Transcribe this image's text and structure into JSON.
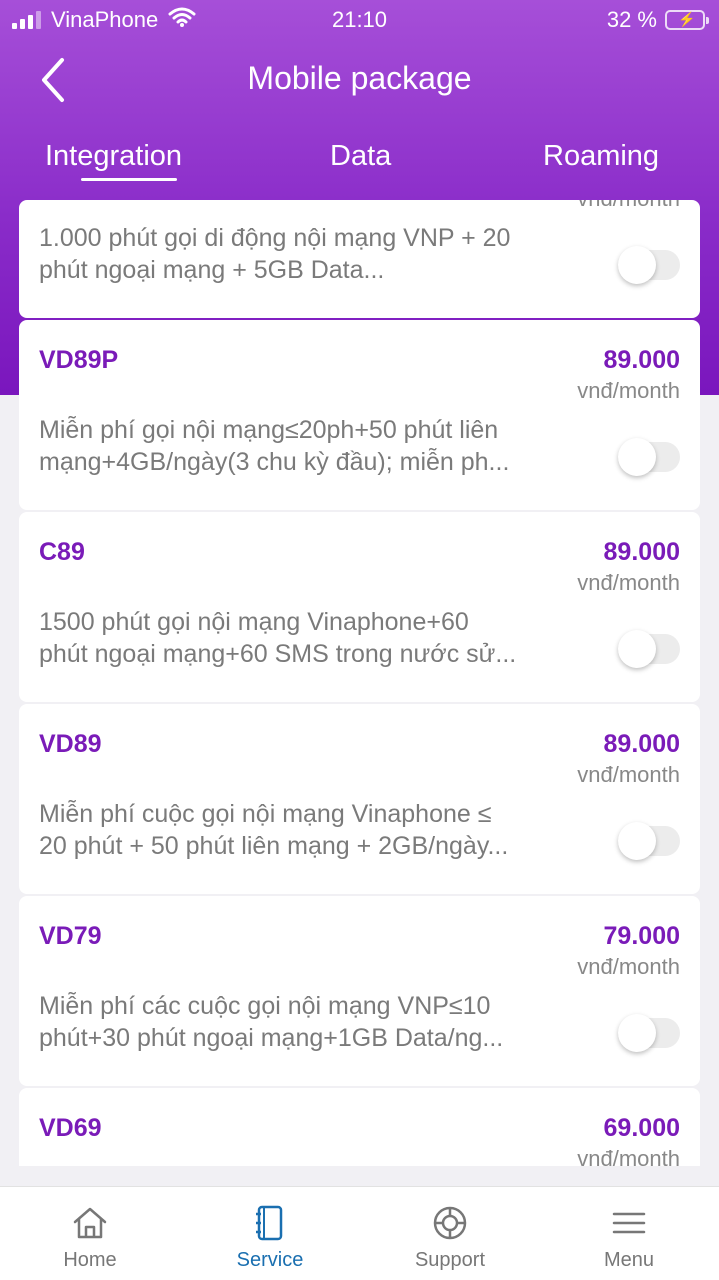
{
  "status_bar": {
    "carrier": "VinaPhone",
    "time": "21:10",
    "battery": "32 %",
    "battery_level": 0.32
  },
  "header": {
    "title": "Mobile package",
    "back_icon": "chevron-left-icon"
  },
  "tabs": [
    {
      "label": "Integration",
      "active": true
    },
    {
      "label": "Data",
      "active": false
    },
    {
      "label": "Roaming",
      "active": false
    }
  ],
  "packages": [
    {
      "code": "",
      "price": "",
      "unit": "vnđ/month",
      "desc_line1": "1.000 phút gọi di động nội mạng VNP + 20",
      "desc_line2": "phút  ngoại mạng + 5GB Data...",
      "enabled": false
    },
    {
      "code": "VD89P",
      "price": "89.000",
      "unit": "vnđ/month",
      "desc_line1": "Miễn phí gọi nội mạng≤20ph+50 phút liên",
      "desc_line2": "mạng+4GB/ngày(3 chu kỳ đầu); miễn ph...",
      "enabled": false
    },
    {
      "code": "C89",
      "price": "89.000",
      "unit": "vnđ/month",
      "desc_line1": "1500 phút gọi nội mạng Vinaphone+60",
      "desc_line2": "phút ngoại mạng+60 SMS trong nước sử...",
      "enabled": false
    },
    {
      "code": "VD89",
      "price": "89.000",
      "unit": "vnđ/month",
      "desc_line1": "Miễn phí cuộc gọi nội mạng Vinaphone ≤",
      "desc_line2": "20 phút + 50 phút liên mạng + 2GB/ngày...",
      "enabled": false
    },
    {
      "code": "VD79",
      "price": "79.000",
      "unit": "vnđ/month",
      "desc_line1": "Miễn phí các cuộc gọi nội mạng VNP≤10",
      "desc_line2": "phút+30 phút ngoại mạng+1GB Data/ng...",
      "enabled": false
    },
    {
      "code": "VD69",
      "price": "69.000",
      "unit": "vnđ/month",
      "desc_line1": "",
      "desc_line2": "",
      "enabled": false
    }
  ],
  "bottom_nav": [
    {
      "label": "Home",
      "icon": "home-icon",
      "active": false
    },
    {
      "label": "Service",
      "icon": "notebook-icon",
      "active": true
    },
    {
      "label": "Support",
      "icon": "lifebuoy-icon",
      "active": false
    },
    {
      "label": "Menu",
      "icon": "hamburger-icon",
      "active": false
    }
  ],
  "colors": {
    "brand_purple": "#8a2cc9",
    "package_text": "#7a1bb8",
    "active_nav": "#1a6fb0"
  }
}
